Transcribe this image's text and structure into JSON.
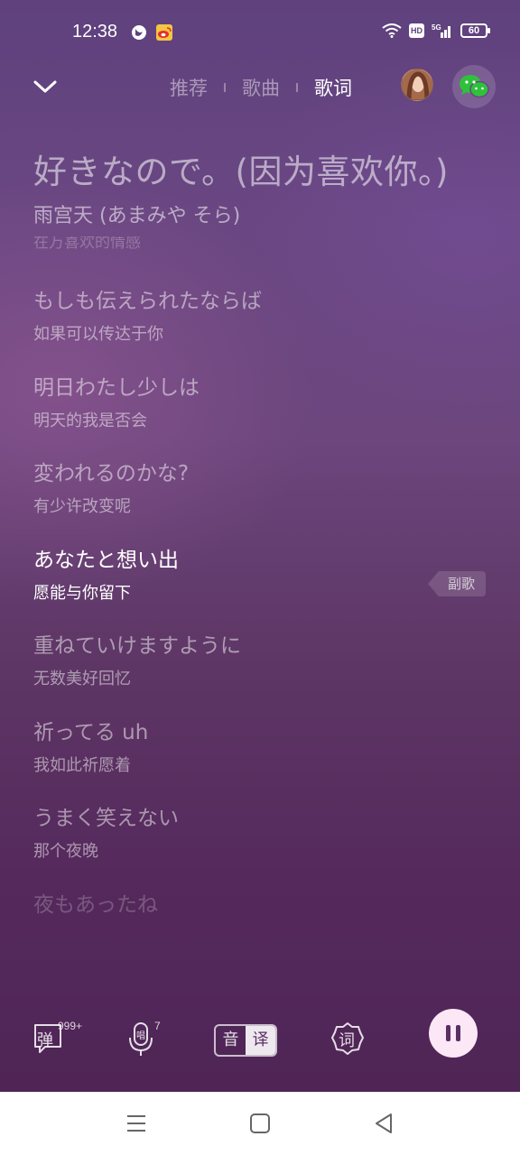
{
  "status_bar": {
    "time": "12:38",
    "battery": "60",
    "hd": "HD",
    "network": "5G",
    "icons": [
      "app-icon",
      "weibo-icon",
      "wifi-icon",
      "hd-icon",
      "signal-icon",
      "battery-icon"
    ]
  },
  "header": {
    "tabs": [
      {
        "label": "推荐",
        "active": false
      },
      {
        "label": "歌曲",
        "active": false
      },
      {
        "label": "歌词",
        "active": true
      }
    ]
  },
  "song": {
    "title": "好きなので。(因为喜欢你。)",
    "artist": "雨宫天 (あまみや そら)"
  },
  "lyrics": {
    "cut_top": "在万喜欢的情感",
    "lines": [
      {
        "jp": "もしも伝えられたならば",
        "cn": "如果可以传达于你"
      },
      {
        "jp": "明日わたし少しは",
        "cn": "明天的我是否会"
      },
      {
        "jp": "変われるのかな?",
        "cn": "有少许改变呢"
      },
      {
        "jp": "あなたと想い出",
        "cn": "愿能与你留下"
      },
      {
        "jp": "重ねていけますように",
        "cn": "无数美好回忆"
      },
      {
        "jp": "祈ってる uh",
        "cn": "我如此祈愿着"
      },
      {
        "jp": "うまく笑えない",
        "cn": "那个夜晚"
      },
      {
        "jp": "夜もあったね",
        "cn": ""
      }
    ],
    "current_index": 3,
    "chorus_tag": "副歌"
  },
  "toolbar": {
    "danmaku_label": "弹",
    "danmaku_count": "999+",
    "sing_count": "7",
    "sound_label": "音",
    "translate_label": "译",
    "lyrics_label": "词"
  },
  "colors": {
    "accent_pause_bg": "#fbe7f5",
    "accent_dark": "#5a2f66",
    "wechat_green": "#2ec23a"
  }
}
